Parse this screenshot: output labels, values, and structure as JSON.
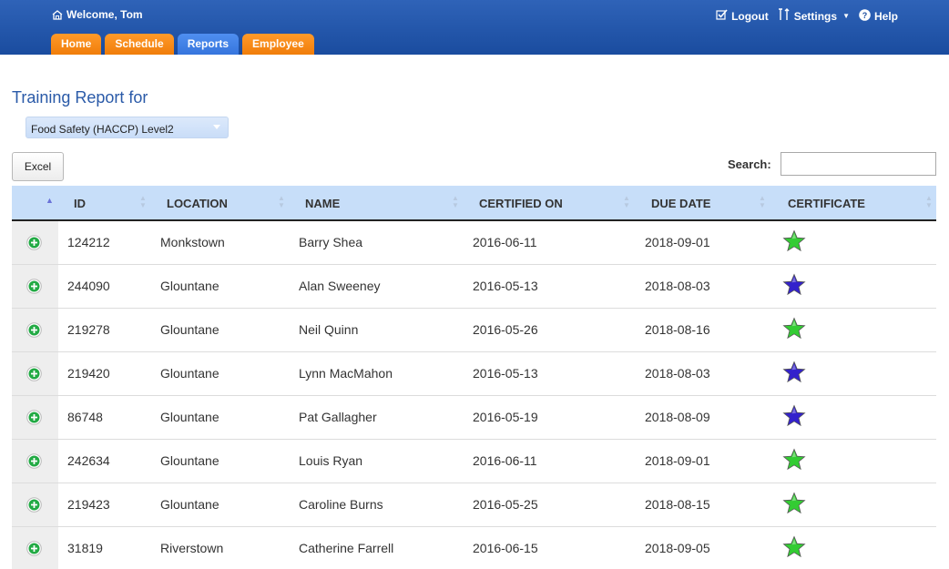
{
  "header": {
    "welcome": "Welcome, Tom",
    "links": {
      "logout": "Logout",
      "settings": "Settings",
      "help": "Help"
    }
  },
  "tabs": [
    {
      "label": "Home",
      "active": false
    },
    {
      "label": "Schedule",
      "active": false
    },
    {
      "label": "Reports",
      "active": true
    },
    {
      "label": "Employee",
      "active": false
    }
  ],
  "report": {
    "title": "Training Report for",
    "course": "Food Safety (HACCP) Level2",
    "excel_label": "Excel",
    "search_label": "Search:",
    "search_value": ""
  },
  "table": {
    "columns": [
      "ID",
      "LOCATION",
      "NAME",
      "CERTIFIED ON",
      "DUE DATE",
      "CERTIFICATE"
    ],
    "rows": [
      {
        "id": "124212",
        "location": "Monkstown",
        "name": "Barry Shea",
        "certified_on": "2016-06-11",
        "due_date": "2018-09-01",
        "certificate": "green"
      },
      {
        "id": "244090",
        "location": "Glountane",
        "name": "Alan Sweeney",
        "certified_on": "2016-05-13",
        "due_date": "2018-08-03",
        "certificate": "blue"
      },
      {
        "id": "219278",
        "location": "Glountane",
        "name": "Neil Quinn",
        "certified_on": "2016-05-26",
        "due_date": "2018-08-16",
        "certificate": "green"
      },
      {
        "id": "219420",
        "location": "Glountane",
        "name": "Lynn MacMahon",
        "certified_on": "2016-05-13",
        "due_date": "2018-08-03",
        "certificate": "blue"
      },
      {
        "id": "86748",
        "location": "Glountane",
        "name": "Pat Gallagher",
        "certified_on": "2016-05-19",
        "due_date": "2018-08-09",
        "certificate": "blue"
      },
      {
        "id": "242634",
        "location": "Glountane",
        "name": "Louis Ryan",
        "certified_on": "2016-06-11",
        "due_date": "2018-09-01",
        "certificate": "green"
      },
      {
        "id": "219423",
        "location": "Glountane",
        "name": "Caroline Burns",
        "certified_on": "2016-05-25",
        "due_date": "2018-08-15",
        "certificate": "green"
      },
      {
        "id": "31819",
        "location": "Riverstown",
        "name": "Catherine Farrell",
        "certified_on": "2016-06-15",
        "due_date": "2018-09-05",
        "certificate": "green"
      }
    ]
  },
  "colors": {
    "header_blue": "#1a4c9f",
    "tab_orange": "#f07d0a",
    "tab_active_blue": "#3675dd",
    "table_header_bg": "#c7def9",
    "star_green": "#33cc33",
    "star_blue": "#3322cc",
    "expand_green": "#22aa44"
  },
  "icons": {
    "home": "home-icon",
    "logout": "checkbox-icon",
    "settings": "tools-icon",
    "help": "question-icon",
    "expand": "plus-circle-icon",
    "certificate": "star-icon"
  }
}
